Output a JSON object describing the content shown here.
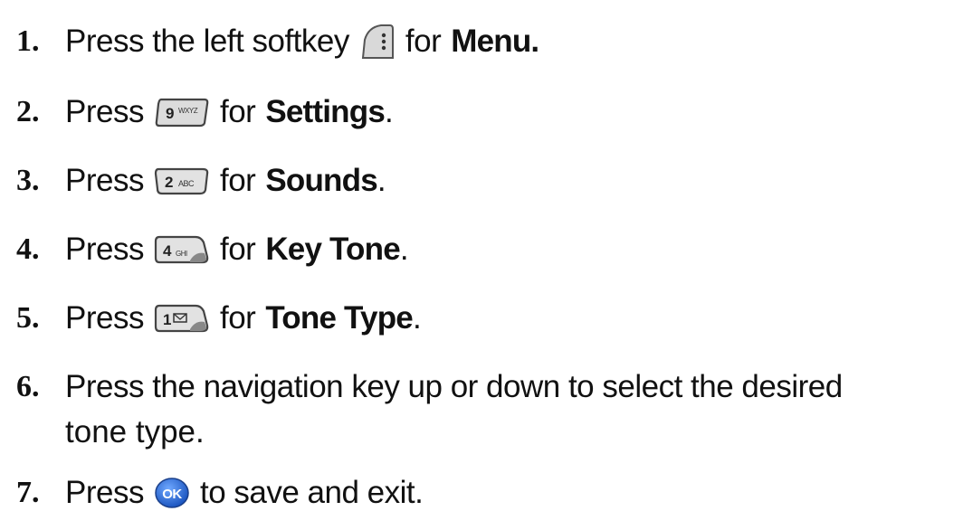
{
  "steps": [
    {
      "number": "1.",
      "before": "Press the left softkey",
      "key": {
        "icon": "left-softkey-icon",
        "label": ""
      },
      "after": "for",
      "bold": "Menu.",
      "end": ""
    },
    {
      "number": "2.",
      "before": "Press",
      "key": {
        "icon": "key-9-icon",
        "label": "9",
        "sub": "WXYZ"
      },
      "after": "for",
      "bold": "Settings",
      "end": "."
    },
    {
      "number": "3.",
      "before": "Press",
      "key": {
        "icon": "key-2-icon",
        "label": "2",
        "sub": "ABC"
      },
      "after": "for",
      "bold": "Sounds",
      "end": "."
    },
    {
      "number": "4.",
      "before": "Press",
      "key": {
        "icon": "key-4-icon",
        "label": "4",
        "sub": "GHI"
      },
      "after": "for",
      "bold": "Key Tone",
      "end": "."
    },
    {
      "number": "5.",
      "before": "Press",
      "key": {
        "icon": "key-1-icon",
        "label": "1",
        "sub": "voicemail"
      },
      "after": "for",
      "bold": "Tone Type",
      "end": "."
    },
    {
      "number": "6.",
      "line1": "Press the navigation key up or down to select the desired",
      "line2": "tone type."
    },
    {
      "number": "7.",
      "before": "Press",
      "key": {
        "icon": "ok-key-icon",
        "label": "OK"
      },
      "after": "to save and exit."
    }
  ],
  "colors": {
    "text": "#111111",
    "ok_key": "#2a6fd6"
  }
}
